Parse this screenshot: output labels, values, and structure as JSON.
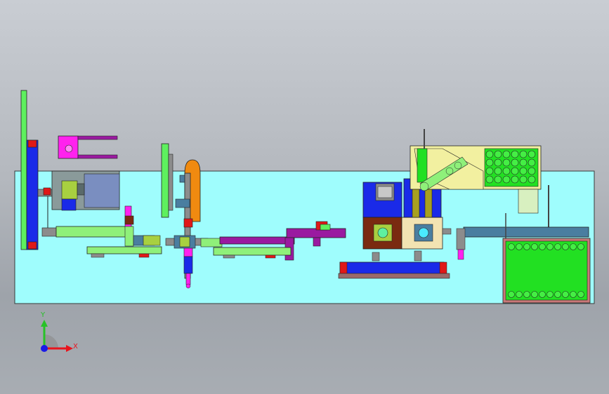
{
  "viewport": {
    "background_top": "#c9cdd3",
    "background_bottom": "#9ea3aa",
    "table_color": "#9ffdfd"
  },
  "triad": {
    "x_label": "X",
    "y_label": "Y",
    "x_color": "#e8141d",
    "y_color": "#27c227",
    "z_color": "#1a1ae6"
  },
  "colors": {
    "green": "#22e022",
    "light_green": "#8ff07a",
    "blue": "#1a2ae8",
    "magenta": "#ff22ee",
    "purple": "#9a1aa0",
    "brown": "#7a2a10",
    "tan": "#f2e3b2",
    "yellow_green": "#a8d040",
    "orange": "#f08a10",
    "red": "#e01818",
    "gray": "#8c8c8c",
    "steel_blue": "#4a7ea0"
  }
}
